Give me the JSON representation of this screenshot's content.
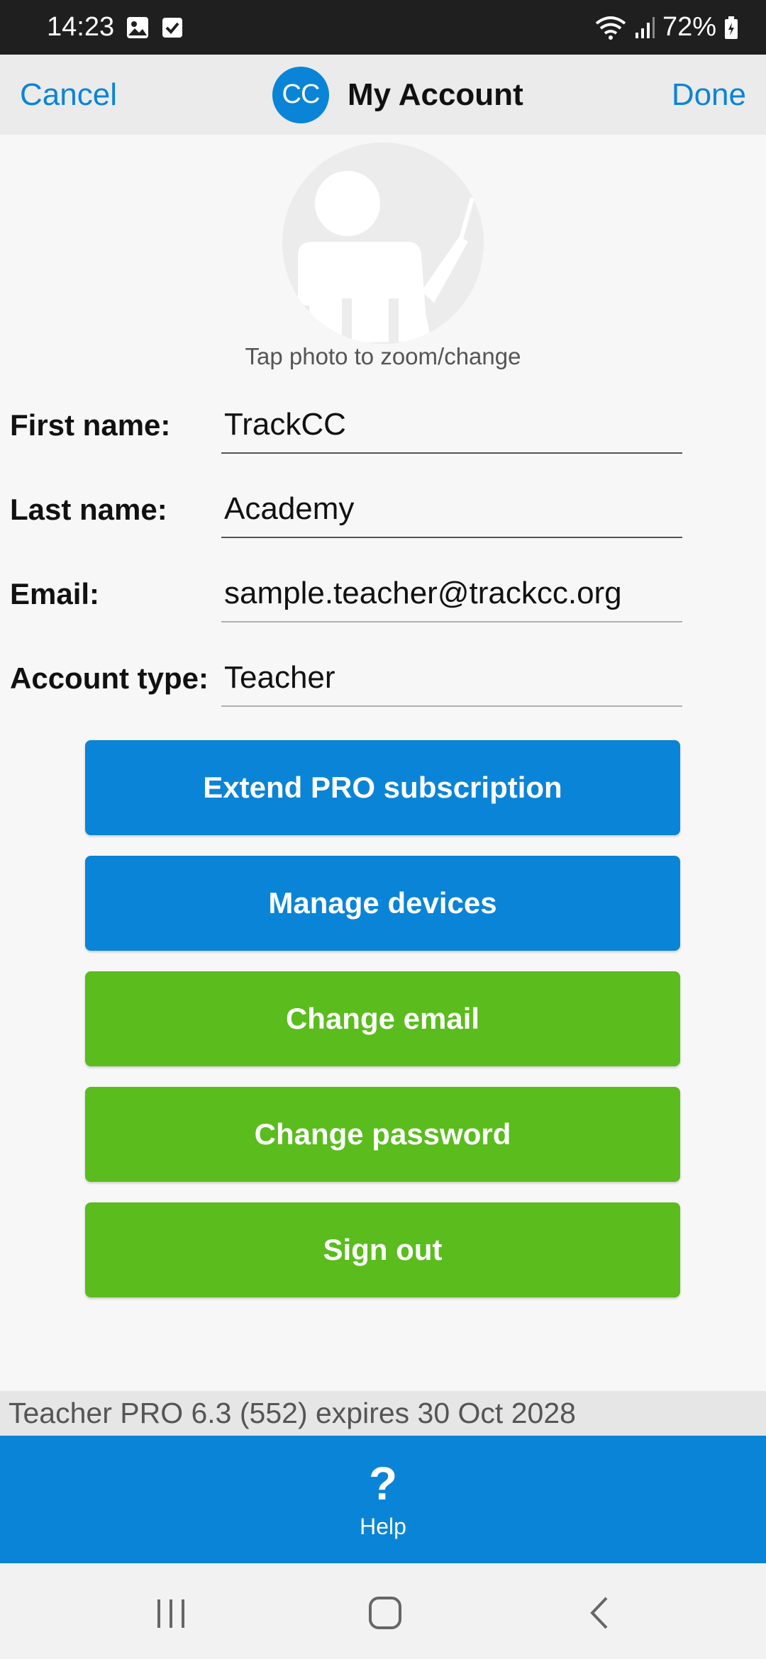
{
  "status_bar": {
    "time": "14:23",
    "battery": "72%",
    "icons": [
      "gallery-icon",
      "check-icon",
      "wifi-icon",
      "signal-icon",
      "battery-icon"
    ]
  },
  "nav": {
    "cancel_label": "Cancel",
    "logo_text": "CC",
    "title": "My Account",
    "done_label": "Done"
  },
  "profile": {
    "photo_caption": "Tap photo to zoom/change"
  },
  "form": {
    "first_name_label": "First name:",
    "first_name_value": "TrackCC",
    "last_name_label": "Last name:",
    "last_name_value": "Academy",
    "email_label": "Email:",
    "email_value": "sample.teacher@trackcc.org",
    "account_type_label": "Account type:",
    "account_type_value": "Teacher"
  },
  "actions": {
    "extend_pro": "Extend PRO subscription",
    "manage_devices": "Manage devices",
    "change_email": "Change email",
    "change_password": "Change password",
    "sign_out": "Sign out"
  },
  "footer": {
    "version_text": "Teacher PRO 6.3 (552) expires 30 Oct 2028",
    "help_label": "Help",
    "help_glyph": "?"
  },
  "colors": {
    "primary_blue": "#0a84d6",
    "action_green": "#5abc1d",
    "nav_bg": "#ebebeb",
    "status_bar_bg": "#1f1f1f"
  }
}
